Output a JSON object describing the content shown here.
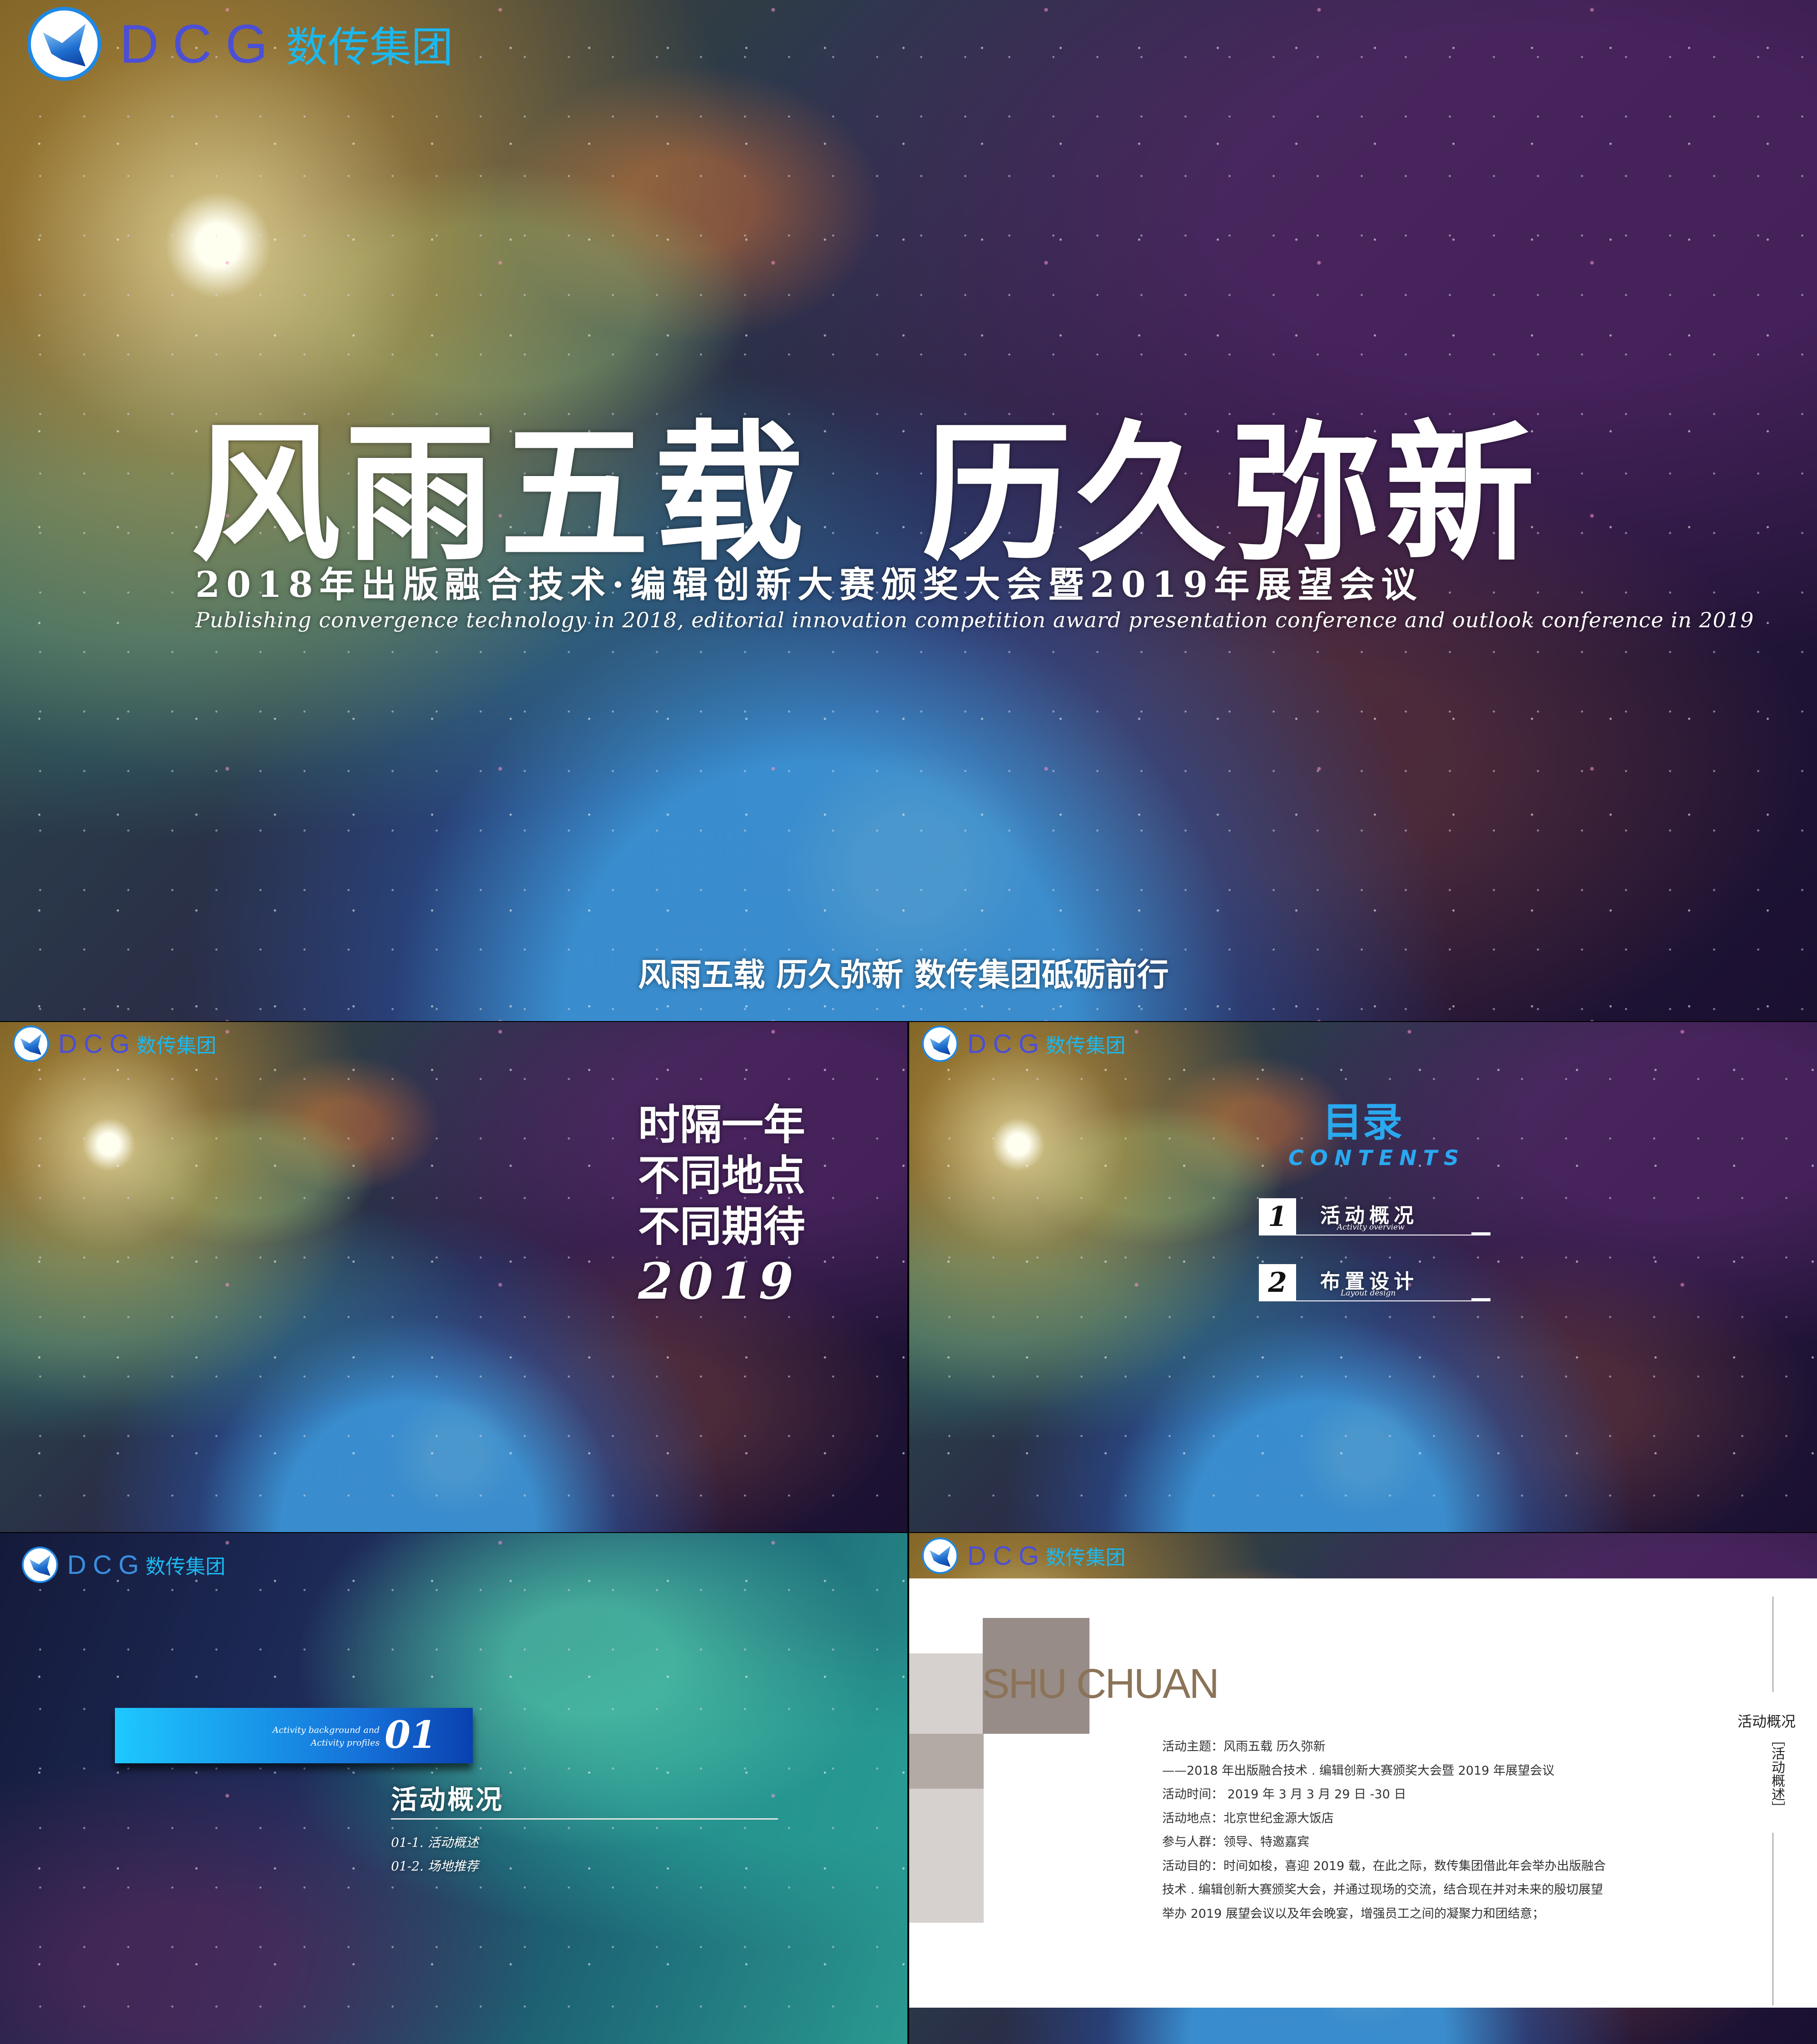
{
  "brand": {
    "en": "DCG",
    "cn": "数传集团",
    "logo_icon": "butterfly-icon",
    "colors": {
      "en": "#4b4fd6",
      "cn": "#1bb8f0"
    }
  },
  "cover": {
    "title": "风雨五载  历久弥新",
    "subtitle": "2018年出版融合技术·编辑创新大赛颁奖大会暨2019年展望会议",
    "subtitle_en": "Publishing convergence technology in 2018, editorial innovation competition award presentation conference and outlook conference in 2019",
    "tagline": "风雨五载 历久弥新 数传集团砥砺前行"
  },
  "intro": {
    "lines": [
      "时隔一年",
      "不同地点",
      "不同期待",
      "2019"
    ]
  },
  "contents": {
    "title": "目录",
    "title_en": "CONTENTS",
    "items": [
      {
        "num": "1",
        "label": "活动概况",
        "sub": "Activity overview"
      },
      {
        "num": "2",
        "label": "布置设计",
        "sub": "Layout design"
      }
    ]
  },
  "section": {
    "number": "01",
    "en_line1": "Activity background and",
    "en_line2": "Activity profiles",
    "title": "活动概况",
    "items": [
      "01-1. 活动概述",
      "01-2. 场地推荐"
    ]
  },
  "overview": {
    "heading": "SHU CHUAN",
    "lines": [
      "活动主题：风雨五载 历久弥新",
      "——2018 年出版融合技术 . 编辑创新大赛颁奖大会暨 2019 年展望会议",
      "活动时间： 2019 年 3 月 3 月 29 日 -30 日",
      "活动地点：北京世纪金源大饭店",
      "参与人群：领导、特邀嘉宾",
      "活动目的：时间如梭，喜迎 2019 载，在此之际，数传集团借此年会举办出版融合",
      "技术 . 编辑创新大赛颁奖大会，并通过现场的交流，结合现在并对未来的殷切展望",
      "举办 2019 展望会议以及年会晚宴，增强员工之间的凝聚力和团结意；"
    ],
    "side_label": "活动概况",
    "side_vertical": "［活动概述］",
    "heading_color": "#8b7358"
  }
}
